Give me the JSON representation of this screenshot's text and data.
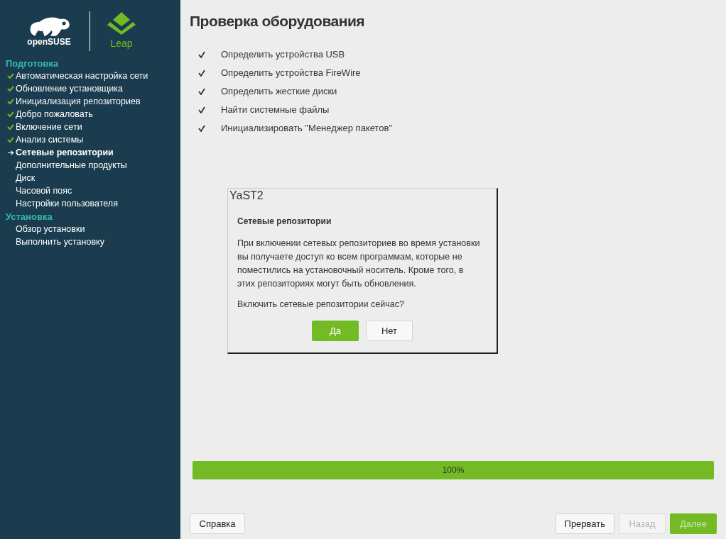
{
  "logo": {
    "brand": "openSUSE",
    "product": "Leap"
  },
  "sidebar": {
    "sections": [
      {
        "title": "Подготовка",
        "items": [
          {
            "label": "Автоматическая настройка сети",
            "done": true,
            "current": false
          },
          {
            "label": "Обновление установщика",
            "done": true,
            "current": false
          },
          {
            "label": "Инициализация репозиториев",
            "done": true,
            "current": false
          },
          {
            "label": "Добро пожаловать",
            "done": true,
            "current": false
          },
          {
            "label": "Включение сети",
            "done": true,
            "current": false
          },
          {
            "label": "Анализ системы",
            "done": true,
            "current": false
          },
          {
            "label": "Сетевые репозитории",
            "done": false,
            "current": true
          },
          {
            "label": "Дополнительные продукты",
            "done": false,
            "current": false
          },
          {
            "label": "Диск",
            "done": false,
            "current": false
          },
          {
            "label": "Часовой пояс",
            "done": false,
            "current": false
          },
          {
            "label": "Настройки пользователя",
            "done": false,
            "current": false
          }
        ]
      },
      {
        "title": "Установка",
        "items": [
          {
            "label": "Обзор установки",
            "done": false,
            "current": false
          },
          {
            "label": "Выполнить установку",
            "done": false,
            "current": false
          }
        ]
      }
    ]
  },
  "page_title": "Проверка оборудования",
  "steps": [
    {
      "label": "Определить устройства USB",
      "checked": true
    },
    {
      "label": "Определить устройства FireWire",
      "checked": true
    },
    {
      "label": "Определить жесткие диски",
      "checked": true
    },
    {
      "label": "Найти системные файлы",
      "checked": true
    },
    {
      "label": "Инициализировать \"Менеджер пакетов\"",
      "checked": true
    }
  ],
  "dialog": {
    "title": "YaST2",
    "heading": "Сетевые репозитории",
    "message": "При включении сетевых репозиториев во время установки вы получаете доступ ко всем программам, которые не поместились на установочный носитель. Кроме того, в этих репозиториях могут быть обновления.",
    "question": "Включить сетевые репозитории сейчас?",
    "buttons": [
      {
        "label": "Да",
        "primary": true,
        "disabled": false
      },
      {
        "label": "Нет",
        "primary": false,
        "disabled": false
      }
    ]
  },
  "progress": {
    "level": 1.0,
    "reading": "100%"
  },
  "footer": {
    "left": [
      {
        "label": "Справка",
        "primary": false,
        "disabled": false
      }
    ],
    "right": [
      {
        "label": "Прервать",
        "primary": false,
        "disabled": false
      },
      {
        "label": "Назад",
        "primary": false,
        "disabled": true
      },
      {
        "label": "Далее",
        "primary": true,
        "disabled": true
      }
    ]
  }
}
